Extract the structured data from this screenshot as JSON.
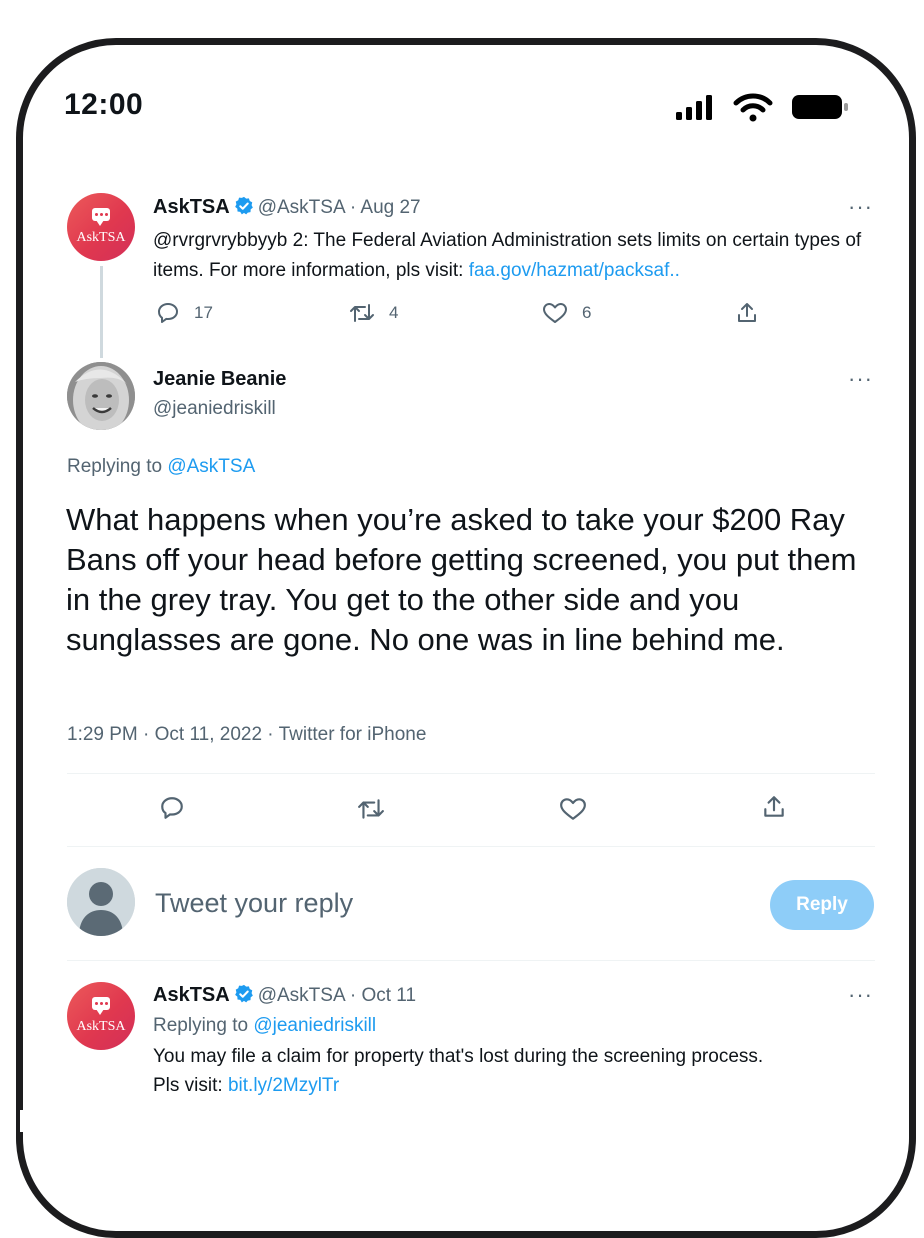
{
  "status_bar": {
    "time": "12:00"
  },
  "tweet_parent": {
    "avatar_label": "AskTSA",
    "name": "AskTSA",
    "handle_date": "@AskTSA · Aug 27",
    "text": "@rvrgrvrybbyyb 2: The Federal Aviation Administration sets limits on certain types of items. For more information, pls visit:",
    "link": "faa.gov/hazmat/packsaf..",
    "replies": "17",
    "retweets": "4",
    "likes": "6",
    "more": "···"
  },
  "main_tweet": {
    "name": "Jeanie Beanie",
    "handle": "@jeaniedriskill",
    "replying_prefix": "Replying to",
    "replying_to": "@AskTSA",
    "text": "What happens when you’re asked to take your $200 Ray Bans off your head before getting screened, you put them in the grey tray. You get to the other side and you sunglasses are gone. No one was in line behind me.",
    "meta": "1:29 PM · Oct 11, 2022 · Twitter for iPhone",
    "more": "···"
  },
  "composer": {
    "placeholder": "Tweet your reply",
    "reply_label": "Reply"
  },
  "reply_tweet": {
    "avatar_label": "AskTSA",
    "name": "AskTSA",
    "handle_date": "@AskTSA · Oct 11",
    "replying_prefix": "Replying to",
    "replying_to": "@jeaniedriskill",
    "line1": "You may file a claim for property that's lost during the screening process.",
    "line2_prefix": "Pls visit:",
    "link": "bit.ly/2MzylTr",
    "more": "···"
  },
  "colors": {
    "accent": "#1d9bf0",
    "verified": "#1d9bf0",
    "tsa_avatar": "#e0384f",
    "reply_button": "#8ecdf8"
  }
}
